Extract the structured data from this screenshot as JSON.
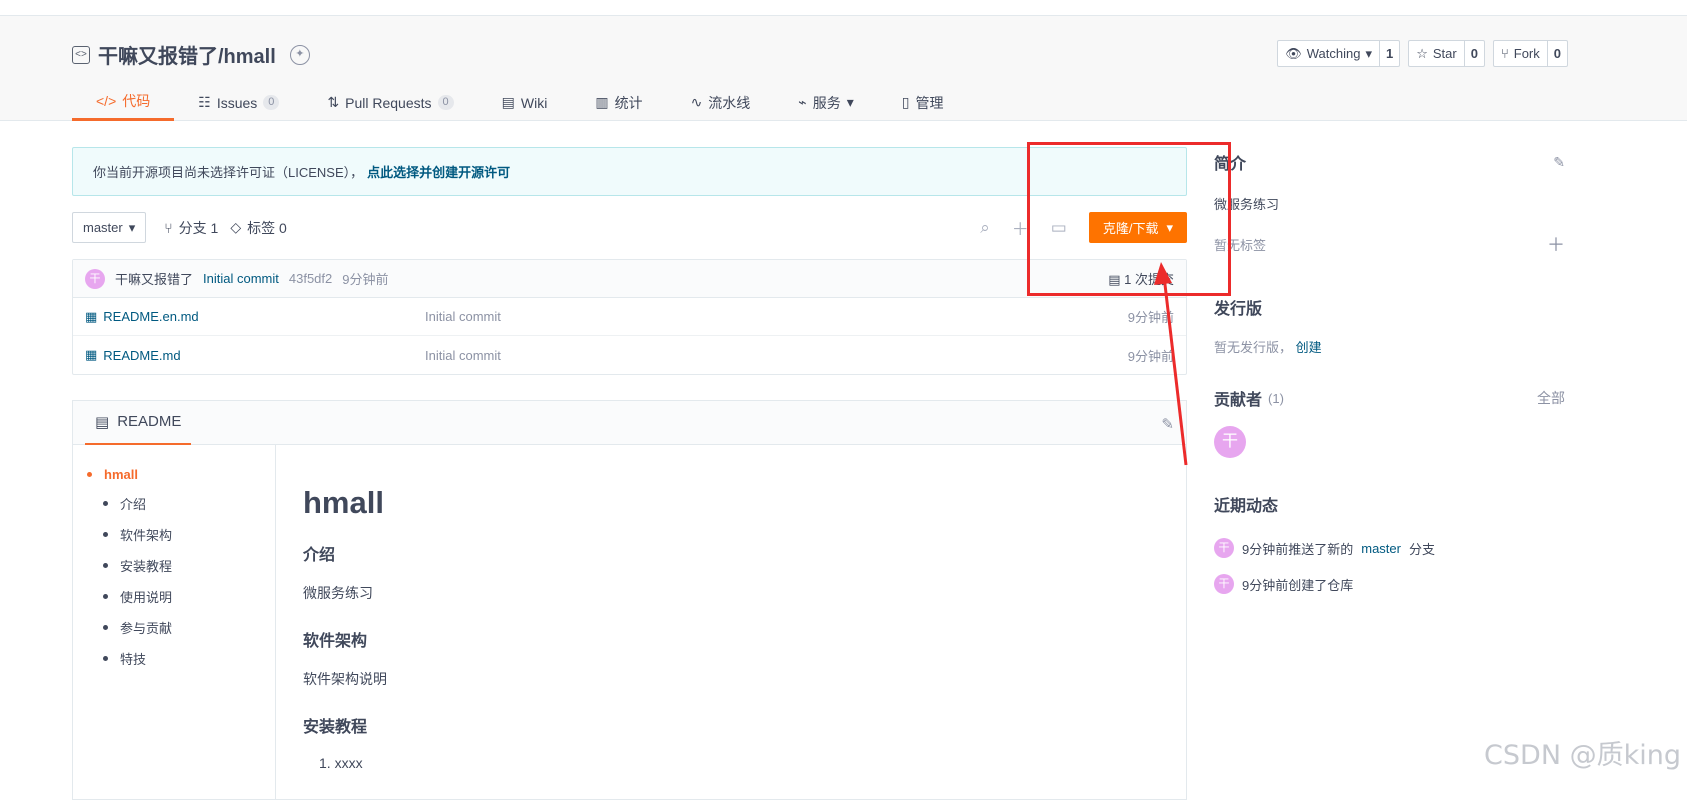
{
  "repo": {
    "owner": "干嘛又报错了",
    "name": "干嘛又报错了/hmall"
  },
  "actions": [
    {
      "label": "Watching",
      "count": "1",
      "icon": "eye-icon"
    },
    {
      "label": "Star",
      "count": "0",
      "icon": "star-icon"
    },
    {
      "label": "Fork",
      "count": "0",
      "icon": "fork-icon"
    }
  ],
  "tabs": [
    {
      "label": "代码",
      "icon": "code-icon",
      "active": true
    },
    {
      "label": "Issues",
      "badge": "0",
      "icon": "issues-icon"
    },
    {
      "label": "Pull Requests",
      "badge": "0",
      "icon": "pr-icon"
    },
    {
      "label": "Wiki",
      "icon": "wiki-icon"
    },
    {
      "label": "统计",
      "icon": "stats-icon"
    },
    {
      "label": "流水线",
      "icon": "pipeline-icon"
    },
    {
      "label": "服务",
      "icon": "service-icon"
    },
    {
      "label": "管理",
      "icon": "manage-icon"
    }
  ],
  "notice": {
    "text": "你当前开源项目尚未选择许可证（LICENSE），",
    "link": "点此选择并创建开源许可"
  },
  "branchbar": {
    "branch": "master",
    "branches": "分支 1",
    "tags": "标签 0",
    "clone_label": "克隆/下载"
  },
  "commit": {
    "avatar": "干",
    "author": "干嘛又报错了",
    "message": "Initial commit",
    "sha": "43f5df2",
    "time": "9分钟前",
    "count": "1 次提交"
  },
  "files": [
    {
      "name": "README.en.md",
      "message": "Initial commit",
      "time": "9分钟前"
    },
    {
      "name": "README.md",
      "message": "Initial commit",
      "time": "9分钟前"
    }
  ],
  "readme": {
    "tab": "README",
    "toc_h1": "hmall",
    "toc": [
      "介绍",
      "软件架构",
      "安装教程",
      "使用说明",
      "参与贡献",
      "特技"
    ],
    "title": "hmall",
    "sec1": "介绍",
    "sec1_text": "微服务练习",
    "sec2": "软件架构",
    "sec2_text": "软件架构说明",
    "sec3": "安装教程",
    "list_item1": "1. xxxx"
  },
  "sidebar": {
    "intro_title": "简介",
    "intro_desc": "微服务练习",
    "no_tags": "暂无标签",
    "release_title": "发行版",
    "no_release": "暂无发行版，",
    "create_link": "创建",
    "contrib_title": "贡献者",
    "contrib_count": "(1)",
    "all_link": "全部",
    "contrib_avatar": "干",
    "activity_title": "近期动态",
    "activity": [
      {
        "avatar": "干",
        "prefix": "9分钟前推送了新的",
        "link": "master",
        "suffix": "分支"
      },
      {
        "avatar": "干",
        "prefix": "9分钟前创建了仓库",
        "link": "",
        "suffix": ""
      }
    ]
  },
  "watermark": "CSDN @质king",
  "colors": {
    "accent": "#fe7300",
    "link": "#005980",
    "annotation": "#ec2b2b"
  }
}
